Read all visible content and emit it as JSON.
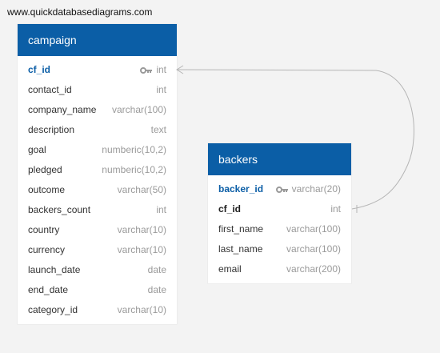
{
  "watermark": "www.quickdatabasediagrams.com",
  "tables": [
    {
      "name": "campaign",
      "fields": [
        {
          "name": "cf_id",
          "type": "int",
          "pk": true
        },
        {
          "name": "contact_id",
          "type": "int"
        },
        {
          "name": "company_name",
          "type": "varchar(100)"
        },
        {
          "name": "description",
          "type": "text"
        },
        {
          "name": "goal",
          "type": "numberic(10,2)"
        },
        {
          "name": "pledged",
          "type": "numberic(10,2)"
        },
        {
          "name": "outcome",
          "type": "varchar(50)"
        },
        {
          "name": "backers_count",
          "type": "int"
        },
        {
          "name": "country",
          "type": "varchar(10)"
        },
        {
          "name": "currency",
          "type": "varchar(10)"
        },
        {
          "name": "launch_date",
          "type": "date"
        },
        {
          "name": "end_date",
          "type": "date"
        },
        {
          "name": "category_id",
          "type": "varchar(10)"
        }
      ]
    },
    {
      "name": "backers",
      "fields": [
        {
          "name": "backer_id",
          "type": "varchar(20)",
          "pk": true
        },
        {
          "name": "cf_id",
          "type": "int",
          "fk": true
        },
        {
          "name": "first_name",
          "type": "varchar(100)"
        },
        {
          "name": "last_name",
          "type": "varchar(100)"
        },
        {
          "name": "email",
          "type": "varchar(200)"
        }
      ]
    }
  ],
  "relationships": [
    {
      "from_table": "backers",
      "from_field": "cf_id",
      "to_table": "campaign",
      "to_field": "cf_id"
    }
  ],
  "colors": {
    "header": "#0b5ea6",
    "pk_text": "#0b5ea6",
    "type_text": "#9a9a9a",
    "link": "#b5b5b5"
  },
  "icons": {
    "primary_key": "key-icon"
  }
}
